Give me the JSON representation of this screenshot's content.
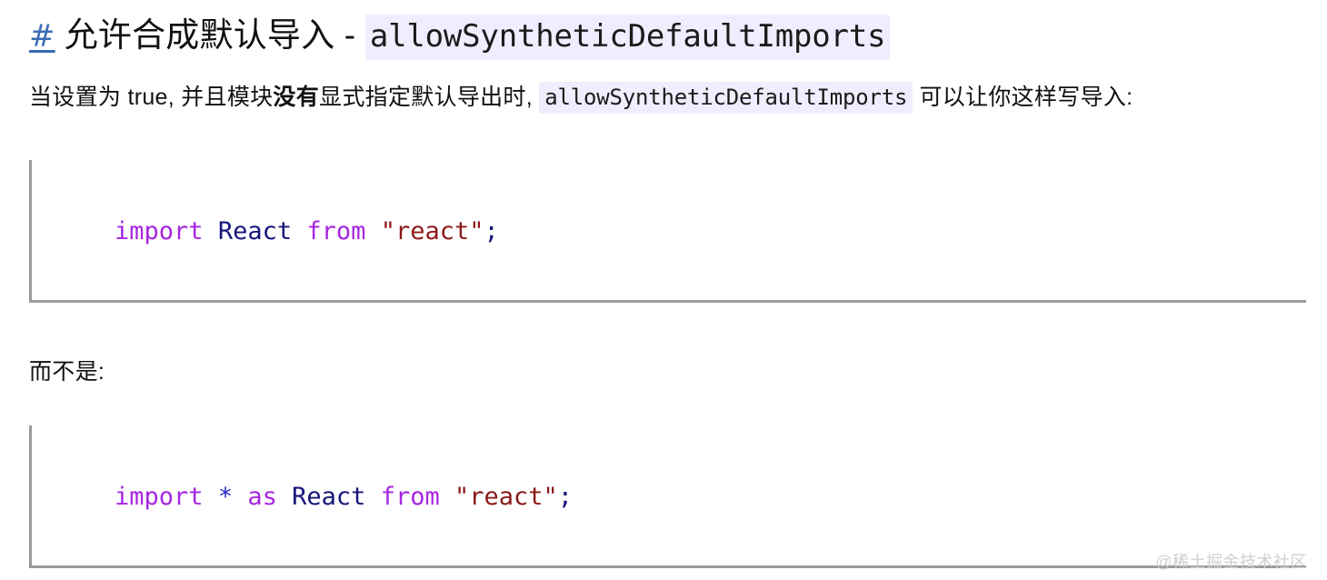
{
  "heading": {
    "anchor_symbol": "#",
    "title_text": "允许合成默认导入",
    "dash": "-",
    "code_text": "allowSyntheticDefaultImports"
  },
  "paragraph_intro": {
    "part1": "当设置为 true, 并且模块",
    "bold": "没有",
    "part2": "显式指定默认导出时,",
    "code": "allowSyntheticDefaultImports",
    "part3": "可以让你这样写导入:"
  },
  "paragraph_else": {
    "text": "而不是:"
  },
  "code_block_1": {
    "language": "javascript",
    "tokens": [
      {
        "text": "import",
        "type": "keyword"
      },
      {
        "text": " ",
        "type": "plain"
      },
      {
        "text": "React",
        "type": "identifier"
      },
      {
        "text": " ",
        "type": "plain"
      },
      {
        "text": "from",
        "type": "keyword"
      },
      {
        "text": " ",
        "type": "plain"
      },
      {
        "text": "\"react\"",
        "type": "string"
      },
      {
        "text": ";",
        "type": "punctuation"
      }
    ],
    "raw": "import React from \"react\";"
  },
  "code_block_2": {
    "language": "javascript",
    "tokens": [
      {
        "text": "import",
        "type": "keyword"
      },
      {
        "text": " ",
        "type": "plain"
      },
      {
        "text": "*",
        "type": "operator"
      },
      {
        "text": " ",
        "type": "plain"
      },
      {
        "text": "as",
        "type": "keyword"
      },
      {
        "text": " ",
        "type": "plain"
      },
      {
        "text": "React",
        "type": "identifier"
      },
      {
        "text": " ",
        "type": "plain"
      },
      {
        "text": "from",
        "type": "keyword"
      },
      {
        "text": " ",
        "type": "plain"
      },
      {
        "text": "\"react\"",
        "type": "string"
      },
      {
        "text": ";",
        "type": "punctuation"
      }
    ],
    "raw": "import * as React from \"react\";"
  },
  "watermark": {
    "text": "@稀土掘金技术社区"
  },
  "colors": {
    "background": "#ffffff",
    "text": "#111111",
    "anchor_link": "#3b6bb5",
    "inline_code_bg": "#eeeeff",
    "codeblock_border": "#9a9a9a",
    "syntax_keyword": "#a626e0",
    "syntax_identifier": "#16167a",
    "syntax_string": "#8b1a1a",
    "syntax_operator": "#2a2ad0",
    "watermark": "#cfcfcf"
  }
}
